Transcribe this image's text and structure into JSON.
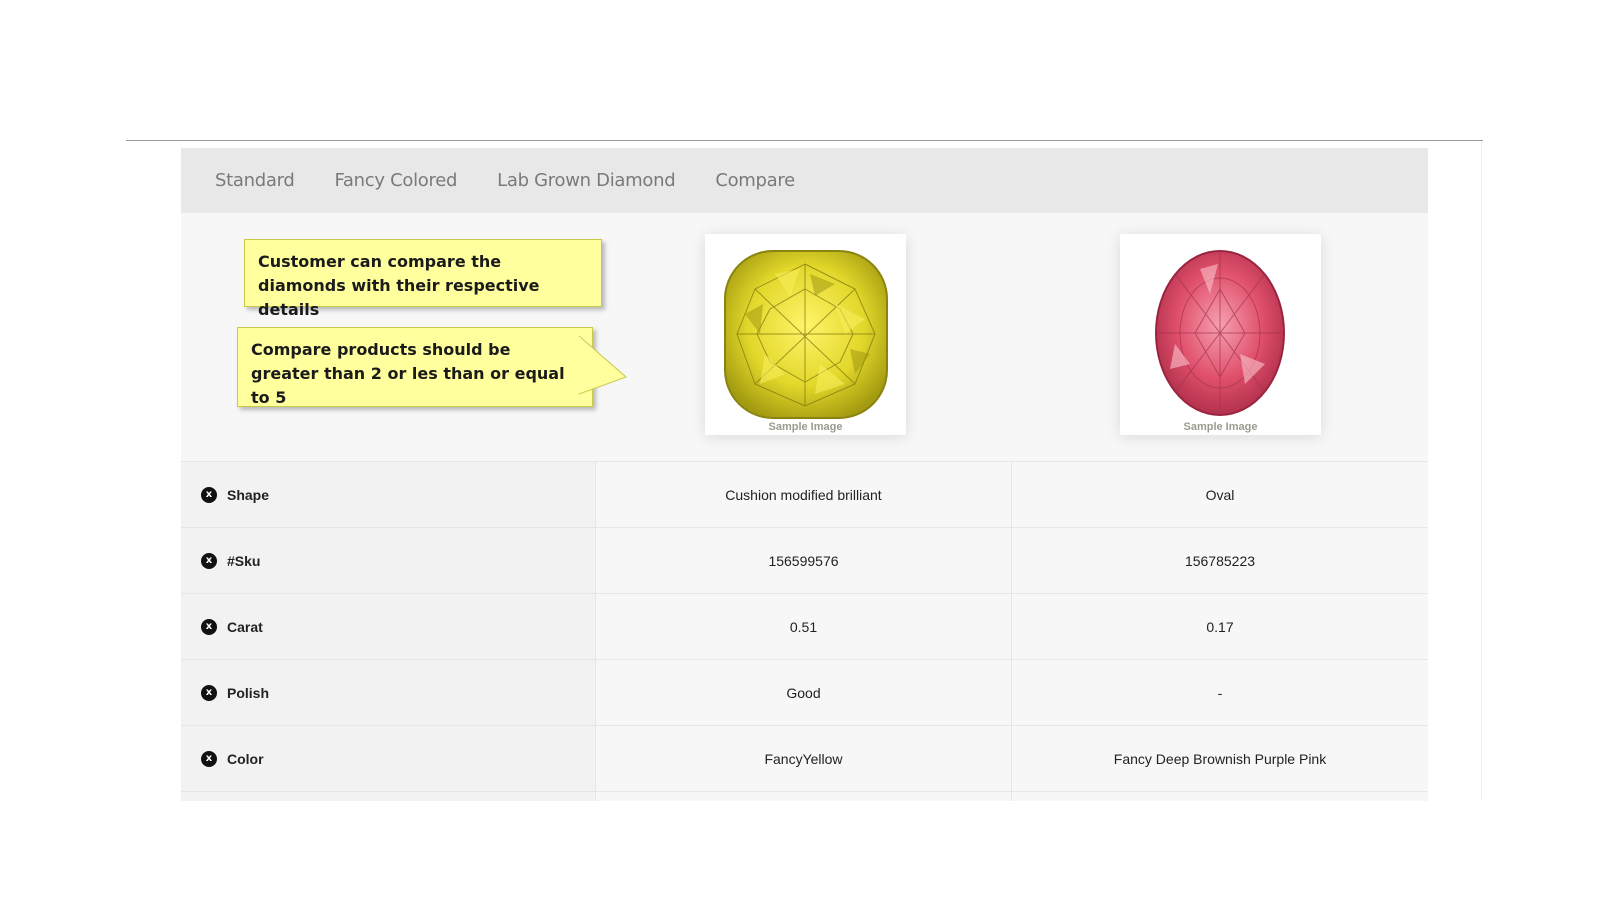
{
  "tabs": [
    {
      "label": "Standard"
    },
    {
      "label": "Fancy Colored"
    },
    {
      "label": "Lab Grown Diamond"
    },
    {
      "label": "Compare"
    }
  ],
  "callouts": {
    "first": "Customer can compare the diamonds with their respective details",
    "second": "Compare products should be greater than 2 or les than or equal to 5"
  },
  "products": [
    {
      "image_label": "Sample Image",
      "icon": "cushion-diamond-icon",
      "color": "#e2d72a"
    },
    {
      "image_label": "Sample Image",
      "icon": "oval-diamond-icon",
      "color": "#e0506c"
    }
  ],
  "rows": [
    {
      "label": "Shape",
      "values": [
        "Cushion modified brilliant",
        "Oval"
      ]
    },
    {
      "label": "#Sku",
      "values": [
        "156599576",
        "156785223"
      ]
    },
    {
      "label": "Carat",
      "values": [
        "0.51",
        "0.17"
      ]
    },
    {
      "label": "Polish",
      "values": [
        "Good",
        "-"
      ]
    },
    {
      "label": "Color",
      "values": [
        "FancyYellow",
        "Fancy Deep Brownish Purple Pink"
      ]
    }
  ],
  "remove_icon": "x"
}
